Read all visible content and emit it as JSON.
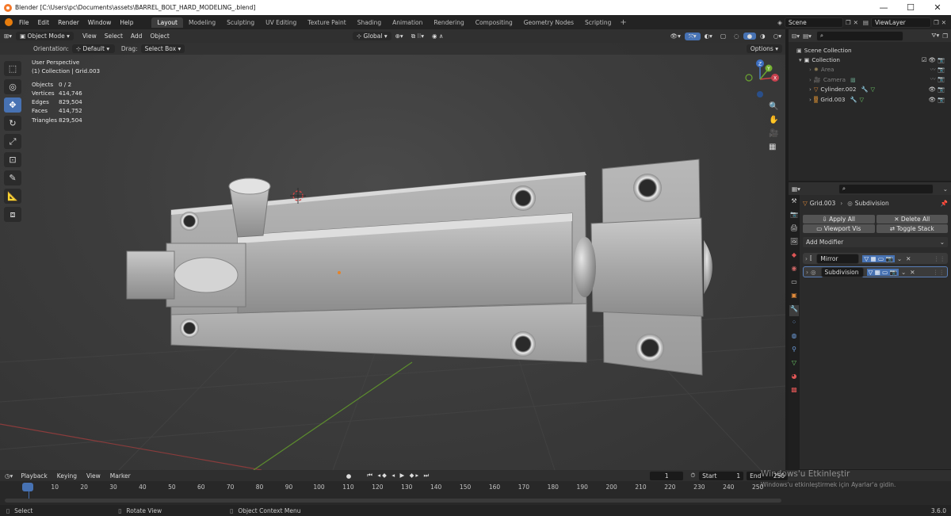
{
  "titlebar": {
    "title": "Blender [C:\\Users\\pc\\Documents\\assets\\BARREL_BOLT_HARD_MODELING_.blend]",
    "min": "—",
    "max": "☐",
    "close": "✕"
  },
  "menu": [
    "File",
    "Edit",
    "Render",
    "Window",
    "Help"
  ],
  "workspaces": [
    "Layout",
    "Modeling",
    "Sculpting",
    "UV Editing",
    "Texture Paint",
    "Shading",
    "Animation",
    "Rendering",
    "Compositing",
    "Geometry Nodes",
    "Scripting"
  ],
  "scene": "Scene",
  "viewlayer": "ViewLayer",
  "viewport": {
    "mode": "Object Mode",
    "menus": [
      "View",
      "Select",
      "Add",
      "Object"
    ],
    "transform": "Global",
    "orientation_label": "Orientation:",
    "orientation": "Default",
    "drag_label": "Drag:",
    "drag": "Select Box",
    "options": "Options",
    "view_name": "User Perspective",
    "collection_info": "(1) Collection | Grid.003",
    "stats": [
      {
        "k": "Objects",
        "v": "0 / 2"
      },
      {
        "k": "Vertices",
        "v": "414,746"
      },
      {
        "k": "Edges",
        "v": "829,504"
      },
      {
        "k": "Faces",
        "v": "414,752"
      },
      {
        "k": "Triangles",
        "v": "829,504"
      }
    ],
    "gizmo": {
      "x": "X",
      "y": "Y",
      "z": "Z"
    }
  },
  "outliner": {
    "root": "Scene Collection",
    "collection": "Collection",
    "items": [
      "Area",
      "Camera",
      "Cylinder.002",
      "Grid.003"
    ]
  },
  "properties": {
    "object": "Grid.003",
    "modifier_crumb": "Subdivision",
    "apply_all": "Apply All",
    "delete_all": "Delete All",
    "viewport_vis": "Viewport Vis",
    "toggle_stack": "Toggle Stack",
    "add_modifier": "Add Modifier",
    "modifiers": [
      "Mirror",
      "Subdivision"
    ]
  },
  "timeline": {
    "menus": [
      "Playback",
      "Keying",
      "View",
      "Marker"
    ],
    "current_frame": "1",
    "start_label": "Start",
    "start": "1",
    "end_label": "End",
    "end": "250",
    "ticks": [
      "1",
      "10",
      "20",
      "30",
      "40",
      "50",
      "60",
      "70",
      "80",
      "90",
      "100",
      "110",
      "120",
      "130",
      "140",
      "150",
      "160",
      "170",
      "180",
      "190",
      "200",
      "210",
      "220",
      "230",
      "240",
      "250"
    ]
  },
  "statusbar": {
    "select": "Select",
    "rotate": "Rotate View",
    "context": "Object Context Menu",
    "version": "3.6.0"
  },
  "watermark": {
    "title": "Windows'u Etkinleştir",
    "sub": "Windows'u etkinleştirmek için Ayarlar'a gidin."
  }
}
